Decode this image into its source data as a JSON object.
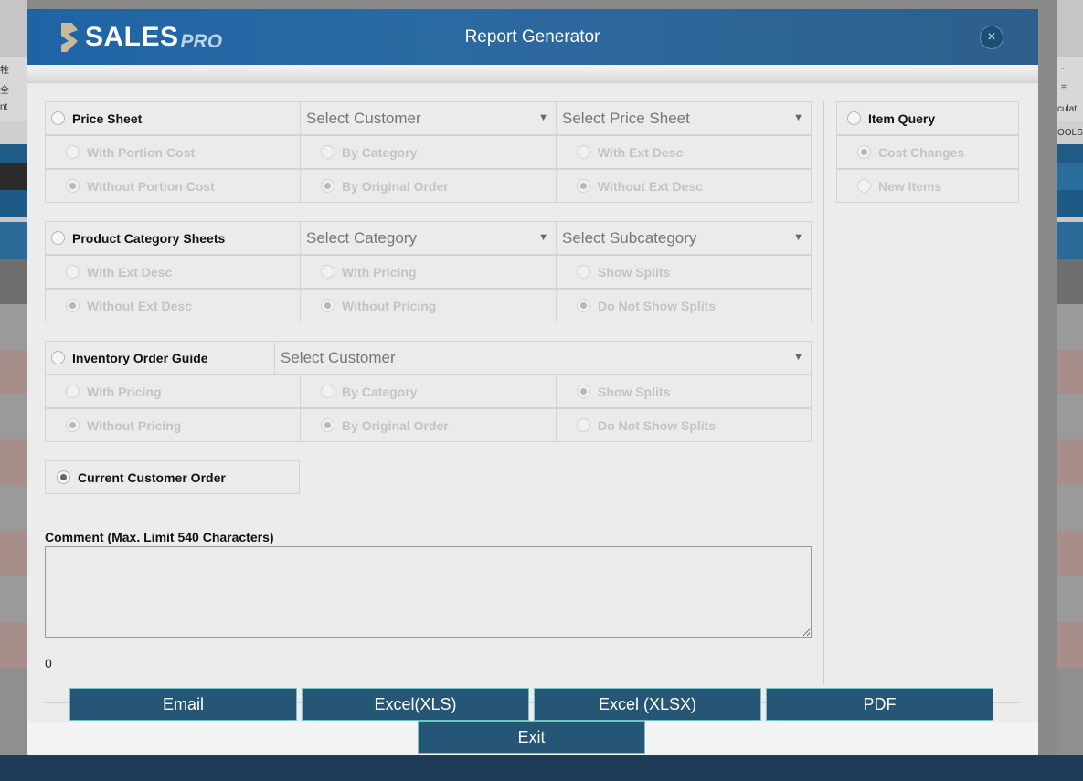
{
  "background": {
    "left_chars": [
      "牲",
      "全",
      "nt"
    ],
    "right_chars": [
      "-",
      "=",
      "culat",
      "OOLS"
    ]
  },
  "header": {
    "logo_main": "SALES",
    "logo_sub": "PRO",
    "title": "Report Generator",
    "close_symbol": "×"
  },
  "price_sheet": {
    "label": "Price Sheet",
    "customer_placeholder": "Select Customer",
    "sheet_placeholder": "Select Price Sheet",
    "options": {
      "with_portion_cost": "With Portion Cost",
      "without_portion_cost": "Without Portion Cost",
      "by_category": "By Category",
      "by_original_order": "By Original Order",
      "with_ext_desc": "With Ext Desc",
      "without_ext_desc": "Without Ext Desc"
    }
  },
  "category_sheets": {
    "label": "Product Category Sheets",
    "category_placeholder": "Select Category",
    "subcategory_placeholder": "Select Subcategory",
    "options": {
      "with_ext_desc": "With Ext Desc",
      "without_ext_desc": "Without Ext Desc",
      "with_pricing": "With Pricing",
      "without_pricing": "Without Pricing",
      "show_splits": "Show Splits",
      "do_not_show_splits": "Do Not Show Splits"
    }
  },
  "order_guide": {
    "label": "Inventory Order Guide",
    "customer_placeholder": "Select Customer",
    "options": {
      "with_pricing": "With Pricing",
      "without_pricing": "Without Pricing",
      "by_category": "By Category",
      "by_original_order": "By Original Order",
      "show_splits": "Show Splits",
      "do_not_show_splits": "Do Not Show Splits"
    }
  },
  "current_order": {
    "label": "Current Customer Order"
  },
  "item_query": {
    "label": "Item Query",
    "options": {
      "cost_changes": "Cost Changes",
      "new_items": "New Items"
    }
  },
  "comment": {
    "label": "Comment (Max. Limit 540 Characters)",
    "value": "",
    "char_count": "0"
  },
  "buttons": {
    "email": "Email",
    "excel_xls": "Excel(XLS)",
    "excel_xlsx": "Excel (XLSX)",
    "pdf": "PDF",
    "exit": "Exit"
  }
}
